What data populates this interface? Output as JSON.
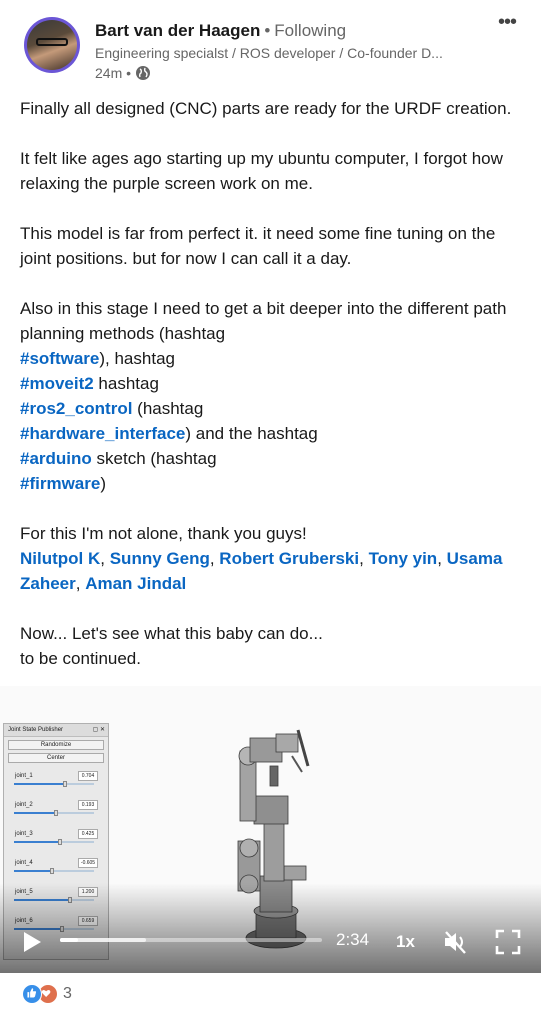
{
  "author": {
    "name": "Bart van der Haagen",
    "separator": "•",
    "follow_status": "Following",
    "headline": "Engineering specialst / ROS developer / Co-founder D...",
    "time": "24m •"
  },
  "post": {
    "p1": "Finally all designed (CNC) parts are ready for the URDF creation.",
    "p2": "It felt like ages ago starting up my ubuntu computer, I forgot how relaxing the purple screen work on me.",
    "p3": "This model is far from perfect it. it need some fine tuning on the joint positions. but for now I can call it a day.",
    "p4_intro": "Also in this stage I need to get a bit deeper into the different path planning methods (hashtag",
    "tag_software": "#software",
    "after_software": "), hashtag",
    "tag_moveit2": "#moveit2",
    "after_moveit2": " hashtag",
    "tag_ros2_control": "#ros2_control",
    "after_ros2_control": " (hashtag",
    "tag_hardware_interface": "#hardware_interface",
    "after_hardware_interface": ") and the hashtag",
    "tag_arduino": "#arduino",
    "after_arduino": " sketch (hashtag",
    "tag_firmware": "#firmware",
    "after_firmware": ")",
    "p5": "For this I'm not alone, thank you guys!",
    "mentions": [
      "Nilutpol K",
      "Sunny Geng",
      "Robert Gruberski",
      "Tony yin",
      "Usama Zaheer",
      "Aman Jindal"
    ],
    "comma": ", ",
    "p6_line1": "Now... Let's see what this baby can do...",
    "p6_line2": "to be continued."
  },
  "video": {
    "jsp": {
      "title": "Joint State Publisher",
      "controls": "▢ ✕",
      "randomize": "Randomize",
      "center": "Center",
      "joints": [
        {
          "label": "joint_1",
          "value": "0.704",
          "level": 0.64
        },
        {
          "label": "joint_2",
          "value": "0.193",
          "level": 0.53
        },
        {
          "label": "joint_3",
          "value": "0.425",
          "level": 0.57
        },
        {
          "label": "joint_4",
          "value": "-0.605",
          "level": 0.48
        },
        {
          "label": "joint_5",
          "value": "1.200",
          "level": 0.7
        },
        {
          "label": "joint_6",
          "value": "0.659",
          "level": 0.6
        }
      ]
    },
    "duration": "2:34",
    "speed": "1x",
    "played_fraction": 0.07,
    "buffered_fraction": 0.33
  },
  "reactions": {
    "count": "3"
  },
  "colors": {
    "link": "#0a66c2",
    "like": "#378fe9",
    "love": "#df704d",
    "avatar_ring": "#6b56d6"
  }
}
